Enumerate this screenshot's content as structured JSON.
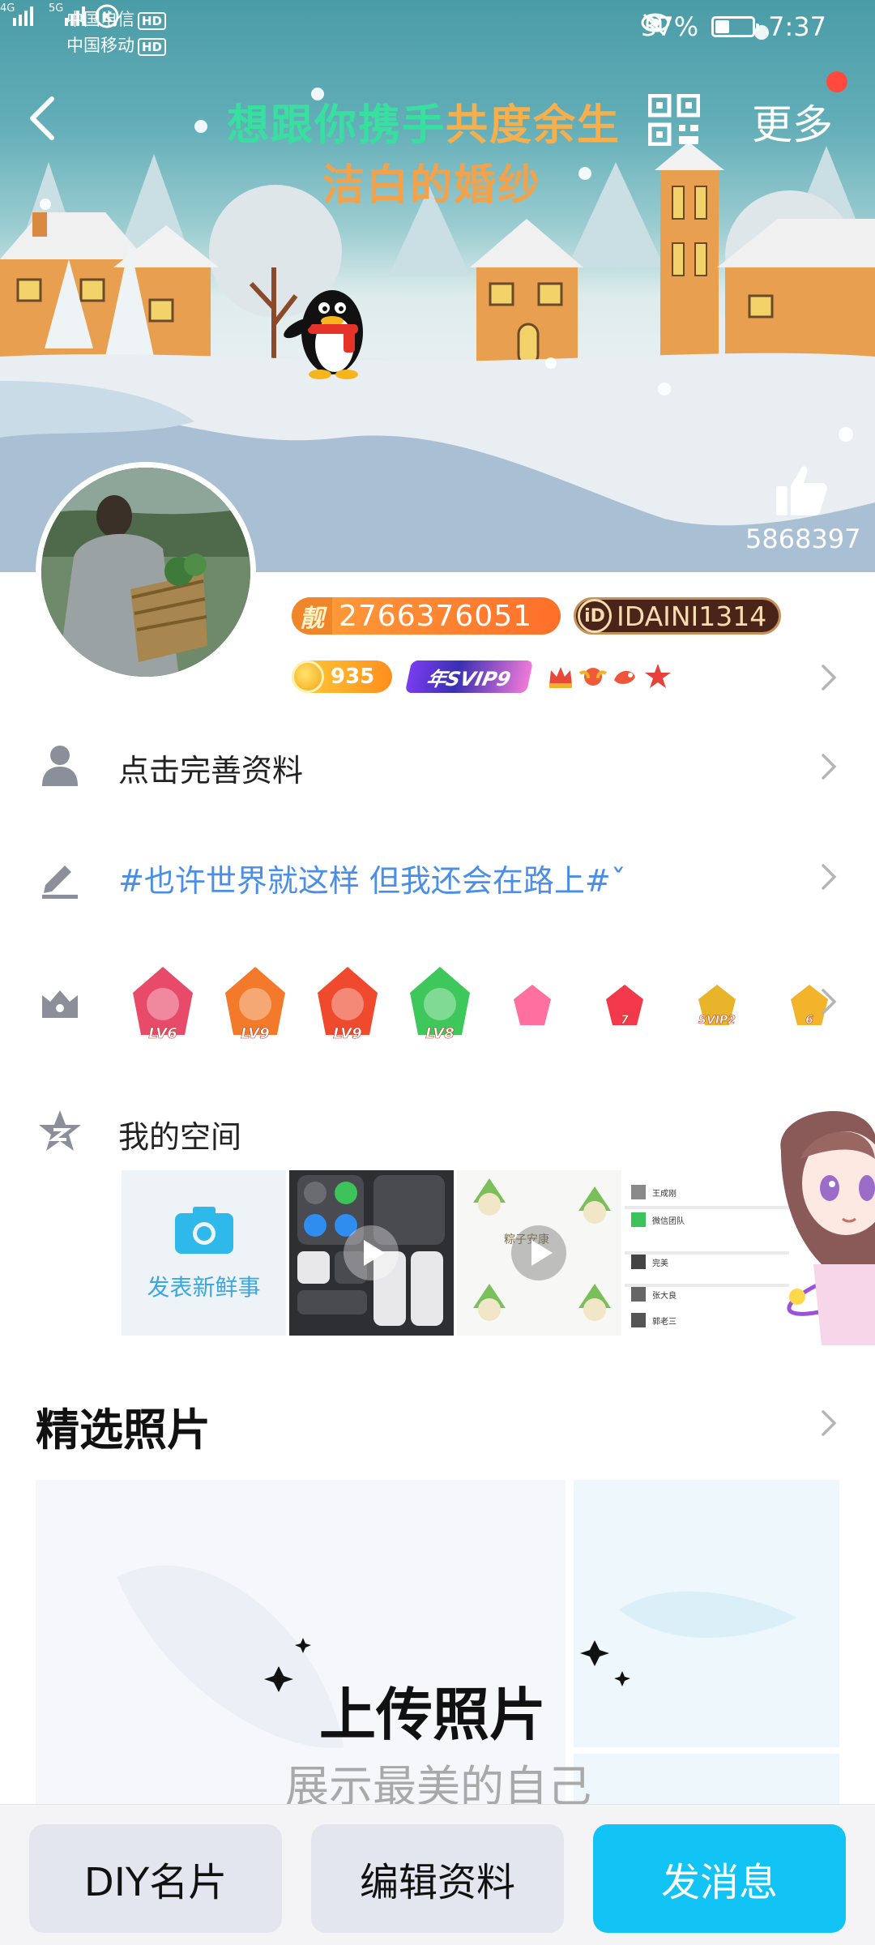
{
  "status_bar": {
    "carrier1": "中国电信",
    "carrier2": "中国移动",
    "hd_label": "HD",
    "network1": "4G",
    "network2": "5G",
    "battery_percent": "37%",
    "battery_level": 0.37,
    "time": "7:37"
  },
  "header": {
    "title_part1": "想跟你携手",
    "title_part2": "共度余生",
    "subtitle": "洁白的婚纱",
    "more_label": "更多",
    "likes": "5868397"
  },
  "profile": {
    "liang_char": "靓",
    "qq_number": "2766376051",
    "id_prefix": "iD",
    "id_value": "IDAINI1314",
    "coin_value": "935",
    "svip_label": "年SVIP9"
  },
  "rows": {
    "complete_profile": "点击完善资料",
    "signature": "#也许世界就这样 但我还会在路上#ˇ",
    "my_space": "我的空间"
  },
  "medals": [
    {
      "label": "LV6",
      "color": "#e84a6a"
    },
    {
      "label": "LV9",
      "color": "#f27a2a"
    },
    {
      "label": "LV9",
      "color": "#f04a2e"
    },
    {
      "label": "LV8",
      "color": "#3ec75a"
    },
    {
      "label": "",
      "color": "#ff6fa0"
    },
    {
      "label": "7",
      "color": "#f2384a"
    },
    {
      "label": "SVIP2",
      "color": "#e8b52a"
    },
    {
      "label": "6",
      "color": "#f2b42a"
    }
  ],
  "space": {
    "new_post_label": "发表新鲜事",
    "thumb3_text": "粽子安康",
    "thumb4_names": [
      "王成刚",
      "微信团队",
      "完美",
      "张大良",
      "郭老三"
    ]
  },
  "photos": {
    "section_title": "精选照片",
    "upload_title": "上传照片",
    "upload_subtitle": "展示最美的自己"
  },
  "bottom_bar": {
    "diy_label": "DIY名片",
    "edit_label": "编辑资料",
    "message_label": "发消息"
  },
  "colors": {
    "accent": "#12c4f5",
    "link": "#4a8ee6",
    "qq_badge": "#ff7a2a"
  }
}
